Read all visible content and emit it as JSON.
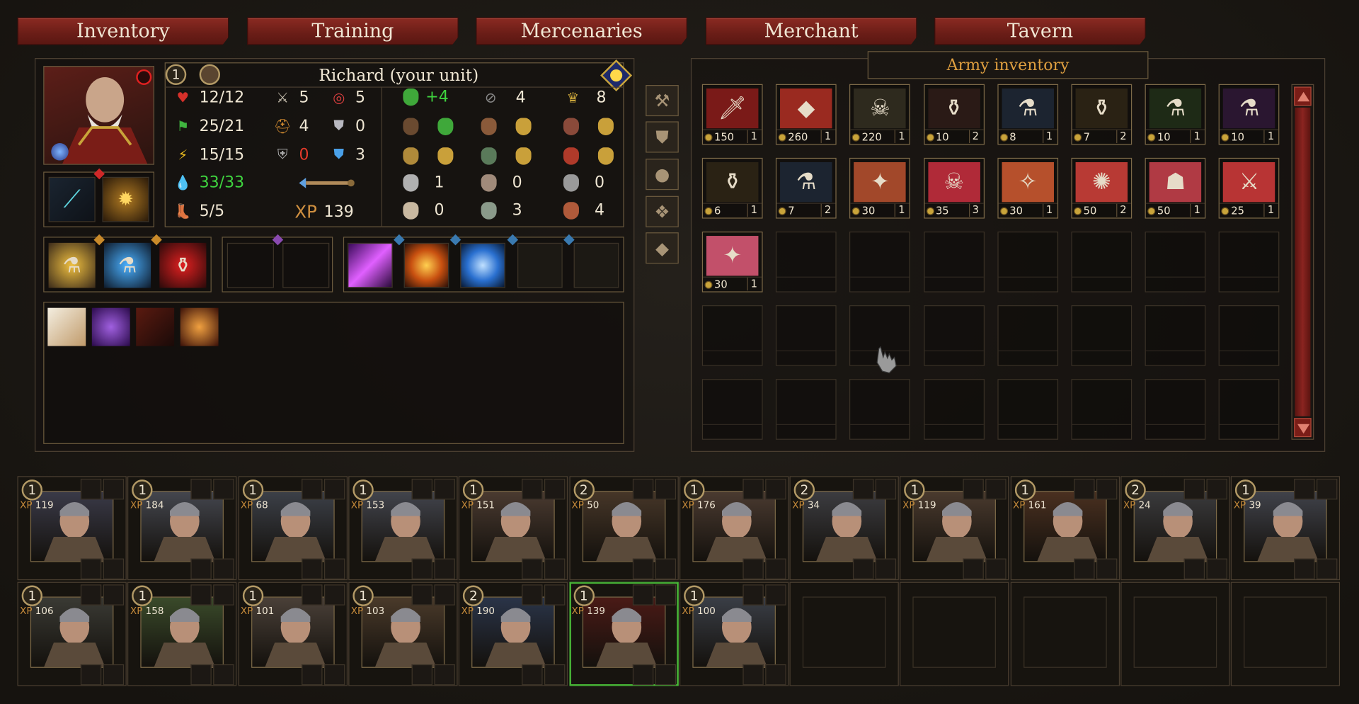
{
  "tabs": [
    "Inventory",
    "Training",
    "Mercenaries",
    "Merchant",
    "Tavern"
  ],
  "hero": {
    "level": "1",
    "name": "Richard (your unit)",
    "stats_left": [
      {
        "icon": "heart-icon",
        "value": "12/12",
        "color": "#efe6d3"
      },
      {
        "icon": "flag-icon",
        "value": "25/21",
        "color": "#efe6d3"
      },
      {
        "icon": "lightning-icon",
        "value": "15/15",
        "color": "#efe6d3"
      },
      {
        "icon": "mana-icon",
        "value": "33/33",
        "color": "#3fd43f"
      },
      {
        "icon": "boot-icon",
        "value": "5/5",
        "color": "#efe6d3"
      }
    ],
    "stats_mid": [
      {
        "icon": "sword-icon",
        "value": "5",
        "color": "#efe6d3"
      },
      {
        "icon": "helmet-icon",
        "value": "4",
        "color": "#efe6d3"
      },
      {
        "icon": "shield-icon",
        "value": "0",
        "color": "#e23a2a"
      },
      {
        "icon": "arrow-icon",
        "value": "",
        "color": "#efe6d3"
      },
      {
        "icon": "xp-icon",
        "value": "139",
        "color": "#efe6d3"
      }
    ],
    "stats_right": [
      {
        "icon": "target-icon",
        "value": "5"
      },
      {
        "icon": "armor-icon",
        "value": "0"
      },
      {
        "icon": "magic-armor-icon",
        "value": "3"
      }
    ],
    "xp_label": "XP",
    "morale": [
      {
        "icon": "green-mask-icon",
        "value": "+4",
        "color": "#3fd43f"
      },
      {
        "icon": "eye-icon",
        "value": "4"
      },
      {
        "icon": "crown-icon",
        "value": "8"
      }
    ],
    "resist_rows": [
      [
        "1",
        "0",
        "0"
      ],
      [
        "0",
        "3",
        "4"
      ]
    ]
  },
  "army_inventory": {
    "title": "Army inventory",
    "items": [
      {
        "price": "150",
        "qty": "1",
        "bg": "#7a1a18",
        "glyph": "🗡"
      },
      {
        "price": "260",
        "qty": "1",
        "bg": "#9a2a20",
        "glyph": "◆"
      },
      {
        "price": "220",
        "qty": "1",
        "bg": "#2e2a1e",
        "glyph": "☠"
      },
      {
        "price": "10",
        "qty": "2",
        "bg": "#2a1a16",
        "glyph": "⚱"
      },
      {
        "price": "8",
        "qty": "1",
        "bg": "#1c2430",
        "glyph": "⚗"
      },
      {
        "price": "7",
        "qty": "2",
        "bg": "#2a2214",
        "glyph": "⚱"
      },
      {
        "price": "10",
        "qty": "1",
        "bg": "#1e2a16",
        "glyph": "⚗"
      },
      {
        "price": "10",
        "qty": "1",
        "bg": "#2a1630",
        "glyph": "⚗"
      },
      {
        "price": "6",
        "qty": "1",
        "bg": "#2a2214",
        "glyph": "⚱"
      },
      {
        "price": "7",
        "qty": "2",
        "bg": "#1c2430",
        "glyph": "⚗"
      },
      {
        "price": "30",
        "qty": "1",
        "bg": "#a2482a",
        "glyph": "✦"
      },
      {
        "price": "35",
        "qty": "3",
        "bg": "#b02a38",
        "glyph": "☠"
      },
      {
        "price": "30",
        "qty": "1",
        "bg": "#b6502c",
        "glyph": "✧"
      },
      {
        "price": "50",
        "qty": "2",
        "bg": "#b83a34",
        "glyph": "✺"
      },
      {
        "price": "50",
        "qty": "1",
        "bg": "#b03a44",
        "glyph": "☗"
      },
      {
        "price": "25",
        "qty": "1",
        "bg": "#b83434",
        "glyph": "⚔"
      },
      {
        "price": "30",
        "qty": "1",
        "bg": "#c2506a",
        "glyph": "✦"
      }
    ]
  },
  "units_row1": [
    {
      "level": "1",
      "xp": "119"
    },
    {
      "level": "1",
      "xp": "184"
    },
    {
      "level": "1",
      "xp": "68"
    },
    {
      "level": "1",
      "xp": "153"
    },
    {
      "level": "1",
      "xp": "151"
    },
    {
      "level": "2",
      "xp": "50"
    },
    {
      "level": "1",
      "xp": "176"
    },
    {
      "level": "2",
      "xp": "34"
    },
    {
      "level": "1",
      "xp": "119"
    },
    {
      "level": "1",
      "xp": "161"
    },
    {
      "level": "2",
      "xp": "24"
    },
    {
      "level": "1",
      "xp": "39"
    }
  ],
  "units_row2": [
    {
      "level": "1",
      "xp": "106"
    },
    {
      "level": "1",
      "xp": "158"
    },
    {
      "level": "1",
      "xp": "101"
    },
    {
      "level": "1",
      "xp": "103"
    },
    {
      "level": "2",
      "xp": "190"
    },
    {
      "level": "1",
      "xp": "139"
    },
    {
      "level": "1",
      "xp": "100"
    }
  ],
  "colors": {
    "tab_red": "#7a241c",
    "gold": "#b39a66",
    "green_value": "#3fd43f",
    "red_value": "#e23a2a",
    "selected_unit": "#4bbf3a"
  }
}
